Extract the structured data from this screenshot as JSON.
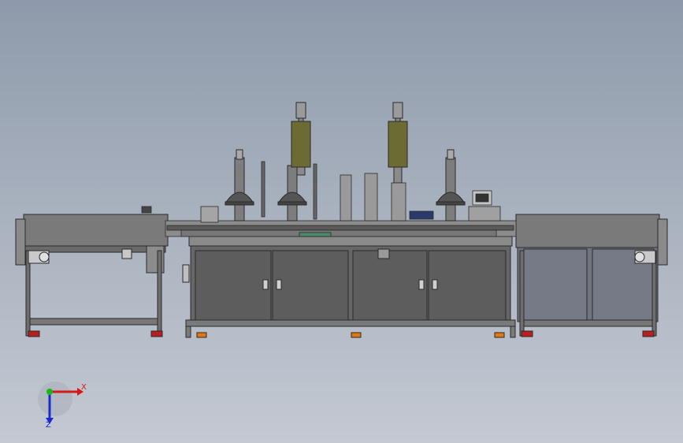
{
  "viewport": {
    "background_top": "#8e9aab",
    "background_bottom": "#c4c9d2"
  },
  "machine": {
    "frame_color": "#6e6e6e",
    "panel_color": "#5d5d5d",
    "edge_color": "#2a2a2a",
    "transformer_color": "#6b6b33",
    "foot_color": "#b82020",
    "orange_foot_color": "#e07a10",
    "components": [
      "left-conveyor",
      "center-cabinet",
      "right-conveyor",
      "press-stations",
      "transformer-towers",
      "dome-covers"
    ]
  },
  "triad": {
    "x_label": "X",
    "z_label": "Z",
    "x_color": "#d81818",
    "y_color": "#18b818",
    "z_color": "#1a2ad0"
  }
}
